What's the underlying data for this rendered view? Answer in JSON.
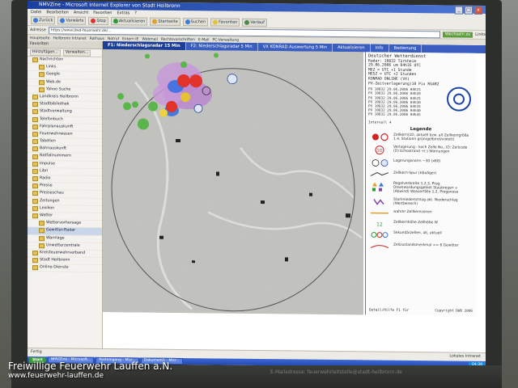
{
  "window": {
    "title": "NMVZine - Microsoft Internet Explorer von Stadt Heilbronn"
  },
  "menubar": [
    "Datei",
    "Bearbeiten",
    "Ansicht",
    "Favoriten",
    "Extras",
    "?"
  ],
  "toolbar": [
    "Zurück",
    "Vorwärts",
    "Stop",
    "Aktualisieren",
    "Startseite",
    "Suchen",
    "Favoriten",
    "Verlauf"
  ],
  "address": {
    "label": "Adresse",
    "url": "https://www.dwd-feuerwehr.de/...",
    "go": "Wechseln zu",
    "links": "Links"
  },
  "links": [
    "Hauptseite",
    "Heilbronn Intranet",
    "Rathaus",
    "Notruf",
    "Extern IE",
    "Webmail",
    "Rechtsvorschriften",
    "E-Mail",
    "PC-Verwaltung"
  ],
  "sidebar": {
    "title": "Favoriten",
    "add_label": "Hinzufügen...",
    "organize_label": "Verwalten...",
    "items": [
      {
        "label": "Nachrichten",
        "sub": false,
        "sel": false
      },
      {
        "label": "Links",
        "sub": true,
        "sel": false
      },
      {
        "label": "Google",
        "sub": true,
        "sel": false
      },
      {
        "label": "Web.de",
        "sub": true,
        "sel": false
      },
      {
        "label": "Yahoo Suche",
        "sub": true,
        "sel": false
      },
      {
        "label": "Landkreis Heilbronn",
        "sub": false,
        "sel": false
      },
      {
        "label": "Stadtbibliothek",
        "sub": false,
        "sel": false
      },
      {
        "label": "Stadtverwaltung",
        "sub": false,
        "sel": false
      },
      {
        "label": "Telefonbuch",
        "sub": false,
        "sel": false
      },
      {
        "label": "Fahrplanauskunft",
        "sub": false,
        "sel": false
      },
      {
        "label": "Feuerwehrwesen",
        "sub": false,
        "sel": false
      },
      {
        "label": "Tabellen",
        "sub": false,
        "sel": false
      },
      {
        "label": "Bahnauskunft",
        "sub": false,
        "sel": false
      },
      {
        "label": "Notfallnummern",
        "sub": false,
        "sel": false
      },
      {
        "label": "Impulse",
        "sub": false,
        "sel": false
      },
      {
        "label": "Libri",
        "sub": false,
        "sel": false
      },
      {
        "label": "Radio",
        "sub": false,
        "sel": false
      },
      {
        "label": "Presse",
        "sub": false,
        "sel": false
      },
      {
        "label": "Presseschau",
        "sub": false,
        "sel": false
      },
      {
        "label": "Zeitungen",
        "sub": false,
        "sel": false
      },
      {
        "label": "Lexikon",
        "sub": false,
        "sel": false
      },
      {
        "label": "Wetter",
        "sub": false,
        "sel": false
      },
      {
        "label": "Wettervorhersage",
        "sub": true,
        "sel": false
      },
      {
        "label": "Gewitter-Radar",
        "sub": true,
        "sel": true
      },
      {
        "label": "Warnlage",
        "sub": true,
        "sel": false
      },
      {
        "label": "Unwetterzentrale",
        "sub": true,
        "sel": false
      },
      {
        "label": "Kreisfeuerwehrverband",
        "sub": false,
        "sel": false
      },
      {
        "label": "Stadt Heilbronn",
        "sub": false,
        "sel": false
      },
      {
        "label": "Online-Dienste",
        "sub": false,
        "sel": false
      }
    ]
  },
  "tabs": [
    {
      "label": "F1: Niederschlagsradar 15 Min",
      "active": true
    },
    {
      "label": "F2: Niederschlagsradar 5 Min",
      "active": false
    },
    {
      "label": "VX KONRAD Auswertung 5 Min",
      "active": false
    },
    {
      "label": "Aktualisieren",
      "active": false
    },
    {
      "label": "Info",
      "active": false
    },
    {
      "label": "Bedienung",
      "active": false
    }
  ],
  "info": {
    "org": "Deutscher Wetterdienst",
    "radar": "Radar: 10832 Türkheim",
    "date": "29.06.2006 um 04h35 UTC",
    "mez": "MEZ  = UTC +1 Stunde",
    "mesz": "MESZ = UTC +2 Stunden",
    "konrad": "KONRAD ONLINE  (VX)",
    "px": "PX-Zeitverlagerung)10 Pix RG4B2",
    "times": [
      "PX 10832 29.06.2006 04h15",
      "PX 10832 29.06.2006 04h20",
      "PX 10832 29.06.2006 04h25",
      "PX 10832 29.06.2006 04h30",
      "PX 10832 29.06.2006 04h35",
      "PX 10832 29.06.2006 04h40",
      "PX 10832 29.06.2006 04h45"
    ],
    "interval": "Intervall 4",
    "legend_title": "Legende",
    "legend": [
      "Zellkern(1D, aktuell bzw. alt Zellkerngröße 1.4, Stationn grün/gelb/rot/violett)",
      "Verlagerung - koch Zelle No., ID: Zellcode (D) Echostrand +(-) Warnungen",
      "Lagerungsnorm ~30 (x60)",
      "Zellkern-Spur (Häufiger)",
      "Regelverbreite 1,2,3, Prog. Downwardungsgebiet Staubregen +(Abwind) Wasserfälle 1,2, Progonose",
      "Starkniederschlag akt. Niederschlag (Wertbereich)",
      "wahrer Zellkernzonen",
      "Zellkernhöhe Zellhöhe W",
      "Sekundärzellen, alt, aktuell",
      "Zellzustandsmerkmal >= 6 Gewitter"
    ],
    "footer_left": "Detail/Hilfe F1 für",
    "footer_right": "Copyright  DWD 2006"
  },
  "statusbar": {
    "text": "Fertig",
    "zone": "Lokales Intranet"
  },
  "taskbar": {
    "start": "Start",
    "tasks": [
      "NMVZine - Microsoft...",
      "Posteingang - Micr...",
      "Dokument1 - Micr..."
    ],
    "clock": "04:39"
  },
  "monitor": {
    "bottom_text": "E-Mailadresse: feuerwehrleitstelle@stadt-heilbronn.de"
  },
  "watermark": {
    "line1": "Freiwillige Feuerwehr Lauffen a.N.",
    "line2": "www.feuerwehr-lauffen.de"
  }
}
